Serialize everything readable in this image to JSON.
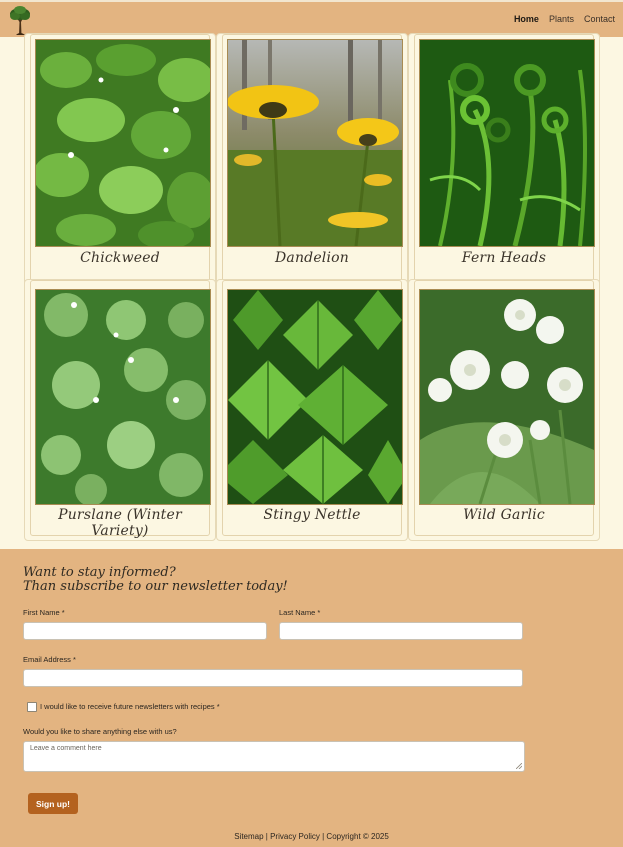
{
  "header": {
    "nav": [
      {
        "label": "Home",
        "active": true
      },
      {
        "label": "Plants",
        "active": false
      },
      {
        "label": "Contact",
        "active": false
      }
    ],
    "logo_icon": "tree-icon"
  },
  "gallery": {
    "items": [
      {
        "name": "Chickweed"
      },
      {
        "name": "Dandelion"
      },
      {
        "name": "Fern Heads"
      },
      {
        "name": "Purslane (Winter Variety)"
      },
      {
        "name": "Stingy Nettle"
      },
      {
        "name": "Wild Garlic"
      }
    ]
  },
  "newsletter": {
    "title_line1": "Want to stay informed?",
    "title_line2": "Than subscribe to our newsletter today!",
    "first_name_label": "First Name *",
    "last_name_label": "Last Name *",
    "email_label": "Email Address *",
    "checkbox_label": "I would like to receive future newsletters with recipes *",
    "comment_label": "Would you like to share anything else with us?",
    "comment_placeholder": "Leave a comment here",
    "submit_label": "Sign up!"
  },
  "footer": {
    "sitemap": "Sitemap",
    "separator": " | ",
    "privacy": "Privacy Policy",
    "copyright": "Copyright © 2025"
  },
  "colors": {
    "header_bg": "#e3b481",
    "page_bg": "#fcf7e2",
    "button_bg": "#b4621f"
  }
}
